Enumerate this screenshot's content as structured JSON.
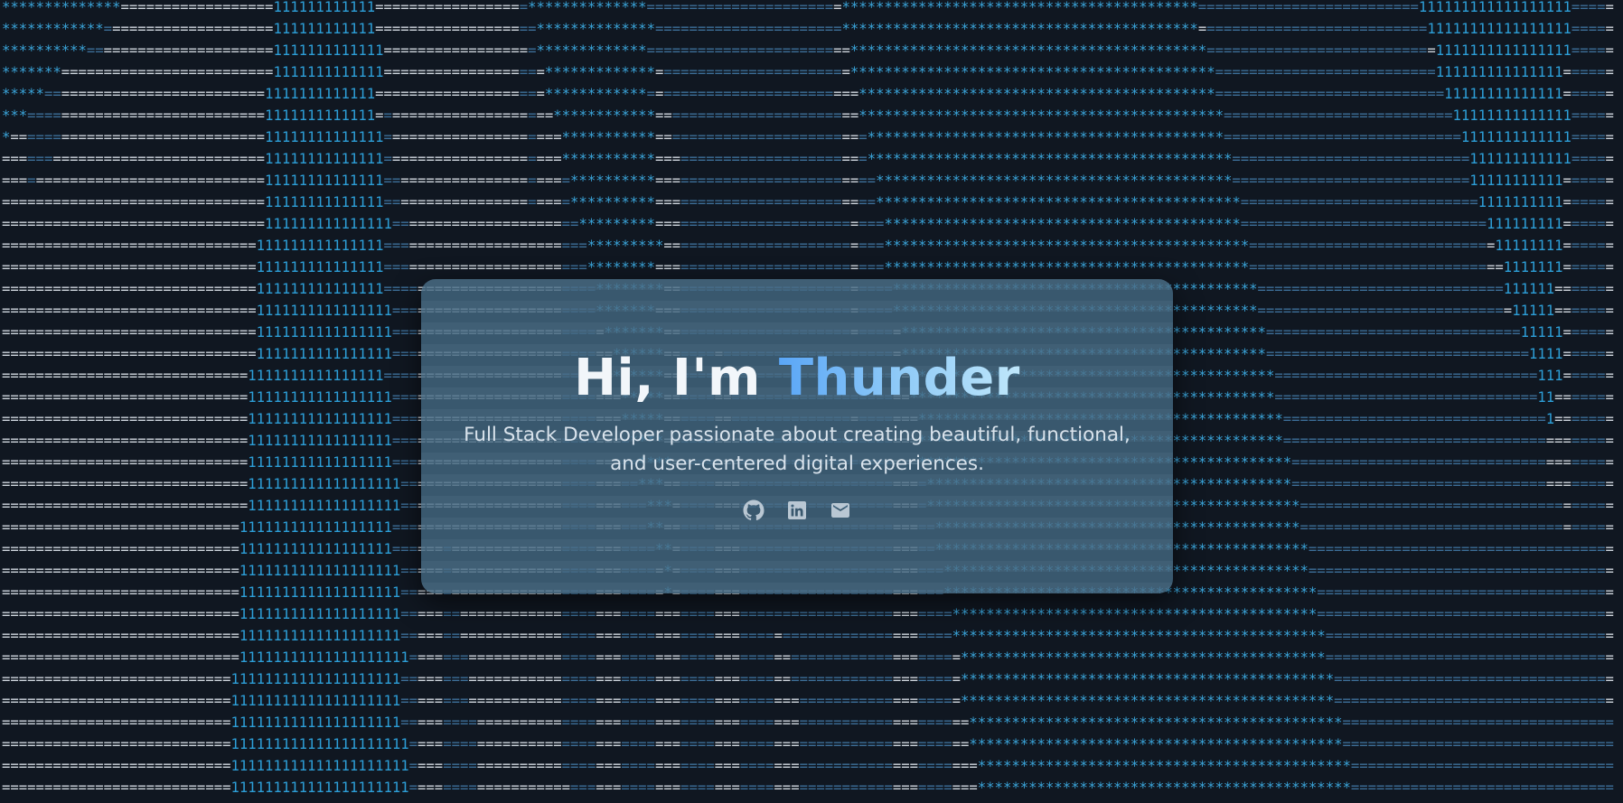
{
  "hero": {
    "greeting": "Hi, I'm ",
    "name": "Thunder",
    "subtitle_line1": "Full Stack Developer passionate about creating beautiful, functional,",
    "subtitle_line2": "and user-centered digital experiences."
  },
  "social": [
    {
      "label": "GitHub",
      "icon": "github-icon"
    },
    {
      "label": "LinkedIn",
      "icon": "linkedin-icon"
    },
    {
      "label": "Email",
      "icon": "mail-icon"
    }
  ],
  "colors": {
    "background": "#101721",
    "card": "#466a84",
    "ascii_white": "#cfd6de",
    "ascii_blue": "#3d6f99",
    "ascii_ones": "#2d9fd8",
    "ascii_stars": "#3aa4d9",
    "name_gradient_start": "#5aa6f7",
    "name_gradient_end": "#bfe7fb"
  }
}
